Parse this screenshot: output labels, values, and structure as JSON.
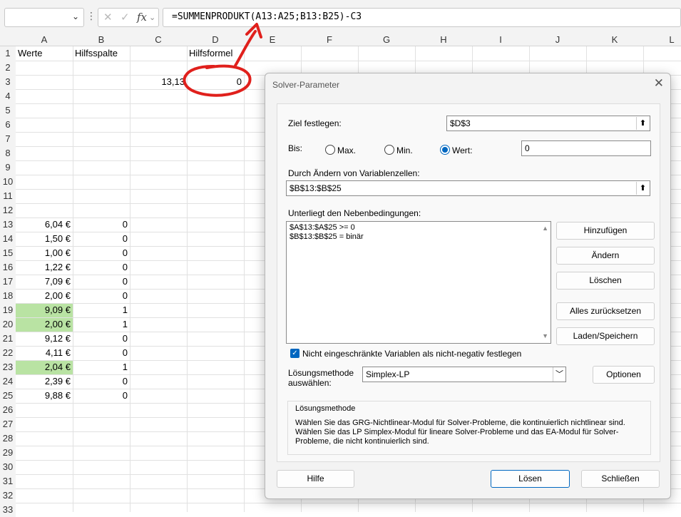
{
  "formula_bar": {
    "name_box_value": "",
    "cancel_glyph": "✕",
    "enter_glyph": "✓",
    "fx_label": "fx",
    "formula": "=SUMMENPRODUKT(A13:A25;B13:B25)-C3"
  },
  "columns": [
    "A",
    "B",
    "C",
    "D",
    "E",
    "F",
    "G",
    "H",
    "I",
    "J",
    "K",
    "L"
  ],
  "rows": [
    "1",
    "2",
    "3",
    "4",
    "5",
    "6",
    "7",
    "8",
    "9",
    "10",
    "11",
    "12",
    "13",
    "14",
    "15",
    "16",
    "17",
    "18",
    "19",
    "20",
    "21",
    "22",
    "23",
    "24",
    "25",
    "26",
    "27",
    "28",
    "29",
    "30",
    "31",
    "32",
    "33"
  ],
  "cells": {
    "A1": "Werte",
    "B1": "Hilfsspalte",
    "D1": "Hilfsformel",
    "C3": "13,13",
    "D3": "0",
    "values_A": [
      "6,04 €",
      "1,50 €",
      "1,00 €",
      "1,22 €",
      "7,09 €",
      "2,00 €",
      "9,09 €",
      "2,00 €",
      "9,12 €",
      "4,11 €",
      "2,04 €",
      "2,39 €",
      "9,88 €"
    ],
    "values_B": [
      "0",
      "0",
      "0",
      "0",
      "0",
      "0",
      "1",
      "1",
      "0",
      "0",
      "1",
      "0",
      "0"
    ]
  },
  "colors": {
    "highlight": "#b9e3a3",
    "annotation": "#e0201c",
    "accent": "#0067c0"
  },
  "dialog": {
    "title": "Solver-Parameter",
    "close_glyph": "✕",
    "ziel_label": "Ziel festlegen:",
    "ziel_value": "$D$3",
    "picker_glyph": "⬆",
    "bis_label": "Bis:",
    "radio_max": "Max.",
    "radio_min": "Min.",
    "radio_wert": "Wert:",
    "selected_radio": "Wert",
    "wert_value": "0",
    "variablen_label": "Durch Ändern von Variablenzellen:",
    "variablen_value": "$B$13:$B$25",
    "nebenbedingungen_label": "Unterliegt den Nebenbedingungen:",
    "constraints": [
      "$A$13:$A$25 >= 0",
      "$B$13:$B$25 = binär"
    ],
    "scroll_up": "▲",
    "scroll_down": "▼",
    "btn_add": "Hinzufügen",
    "btn_change": "Ändern",
    "btn_delete": "Löschen",
    "btn_reset": "Alles zurücksetzen",
    "btn_load_save": "Laden/Speichern",
    "checkbox_glyph": "✓",
    "checkbox_label": "Nicht eingeschränkte Variablen als nicht-negativ festlegen",
    "checkbox_checked": true,
    "method_label_line1": "Lösungsmethode",
    "method_label_line2": "auswählen:",
    "method_value": "Simplex-LP",
    "dropdown_glyph": "﹀",
    "btn_options": "Optionen",
    "method_box_title": "Lösungsmethode",
    "method_desc": "Wählen Sie das GRG-Nichtlinear-Modul für Solver-Probleme, die kontinuierlich nichtlinear sind. Wählen Sie das LP Simplex-Modul für lineare Solver-Probleme und das EA-Modul für Solver-Probleme, die nicht kontinuierlich sind.",
    "btn_help": "Hilfe",
    "btn_solve": "Lösen",
    "btn_close": "Schließen"
  }
}
